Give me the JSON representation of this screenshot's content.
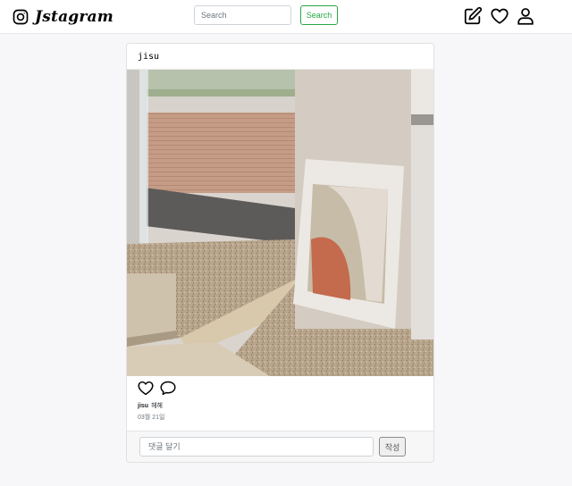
{
  "header": {
    "brand": "Jstagram",
    "search": {
      "placeholder": "Search",
      "value": ""
    },
    "search_button": "Search",
    "icons": [
      "instagram-icon",
      "edit-icon",
      "heart-icon",
      "user-icon"
    ]
  },
  "post": {
    "author": "jisu",
    "image_alt": "",
    "actions": [
      "heart-icon",
      "comment-icon"
    ],
    "caption": {
      "username": "jisu",
      "text": "헤헤"
    },
    "date": "03월 21일"
  },
  "comment": {
    "placeholder": "댓글 달기",
    "value": "",
    "submit_label": "작성"
  },
  "colors": {
    "search_button": "#28a745",
    "page_background": "#f7f7f9"
  }
}
